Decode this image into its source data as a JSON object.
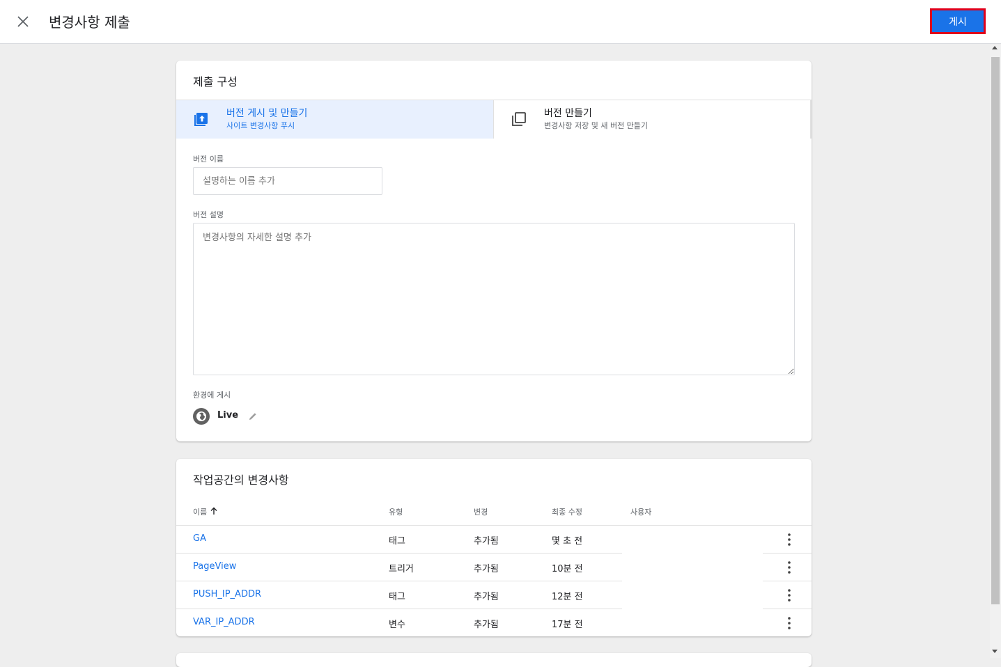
{
  "header": {
    "title": "변경사항 제출",
    "publish_label": "게시",
    "accent_color": "#1a73e8"
  },
  "config": {
    "title": "제출 구성",
    "options": [
      {
        "title": "버전 게시 및 만들기",
        "subtitle": "사이트 변경사항 푸시",
        "icon": "publish-upload-icon",
        "selected": true
      },
      {
        "title": "버전 만들기",
        "subtitle": "변경사항 저장 및 새 버전 만들기",
        "icon": "copy-version-icon",
        "selected": false
      }
    ],
    "version_name": {
      "label": "버전 이름",
      "placeholder": "설명하는 이름 추가",
      "value": ""
    },
    "version_description": {
      "label": "버전 설명",
      "placeholder": "변경사항의 자세한 설명 추가",
      "value": ""
    },
    "environment": {
      "label": "환경에 게시",
      "name": "Live",
      "icon": "globe-icon"
    }
  },
  "changes": {
    "title": "작업공간의 변경사항",
    "columns": [
      "이름",
      "유형",
      "변경",
      "최종 수정",
      "사용자"
    ],
    "sort_column": "이름",
    "sort_direction": "ascending",
    "rows": [
      {
        "name": "GA",
        "type": "태그",
        "change": "추가됨",
        "modified": "몇 초 전",
        "user": ""
      },
      {
        "name": "PageView",
        "type": "트리거",
        "change": "추가됨",
        "modified": "10분 전",
        "user": ""
      },
      {
        "name": "PUSH_IP_ADDR",
        "type": "태그",
        "change": "추가됨",
        "modified": "12분 전",
        "user": ""
      },
      {
        "name": "VAR_IP_ADDR",
        "type": "변수",
        "change": "추가됨",
        "modified": "17분 전",
        "user": ""
      }
    ]
  }
}
